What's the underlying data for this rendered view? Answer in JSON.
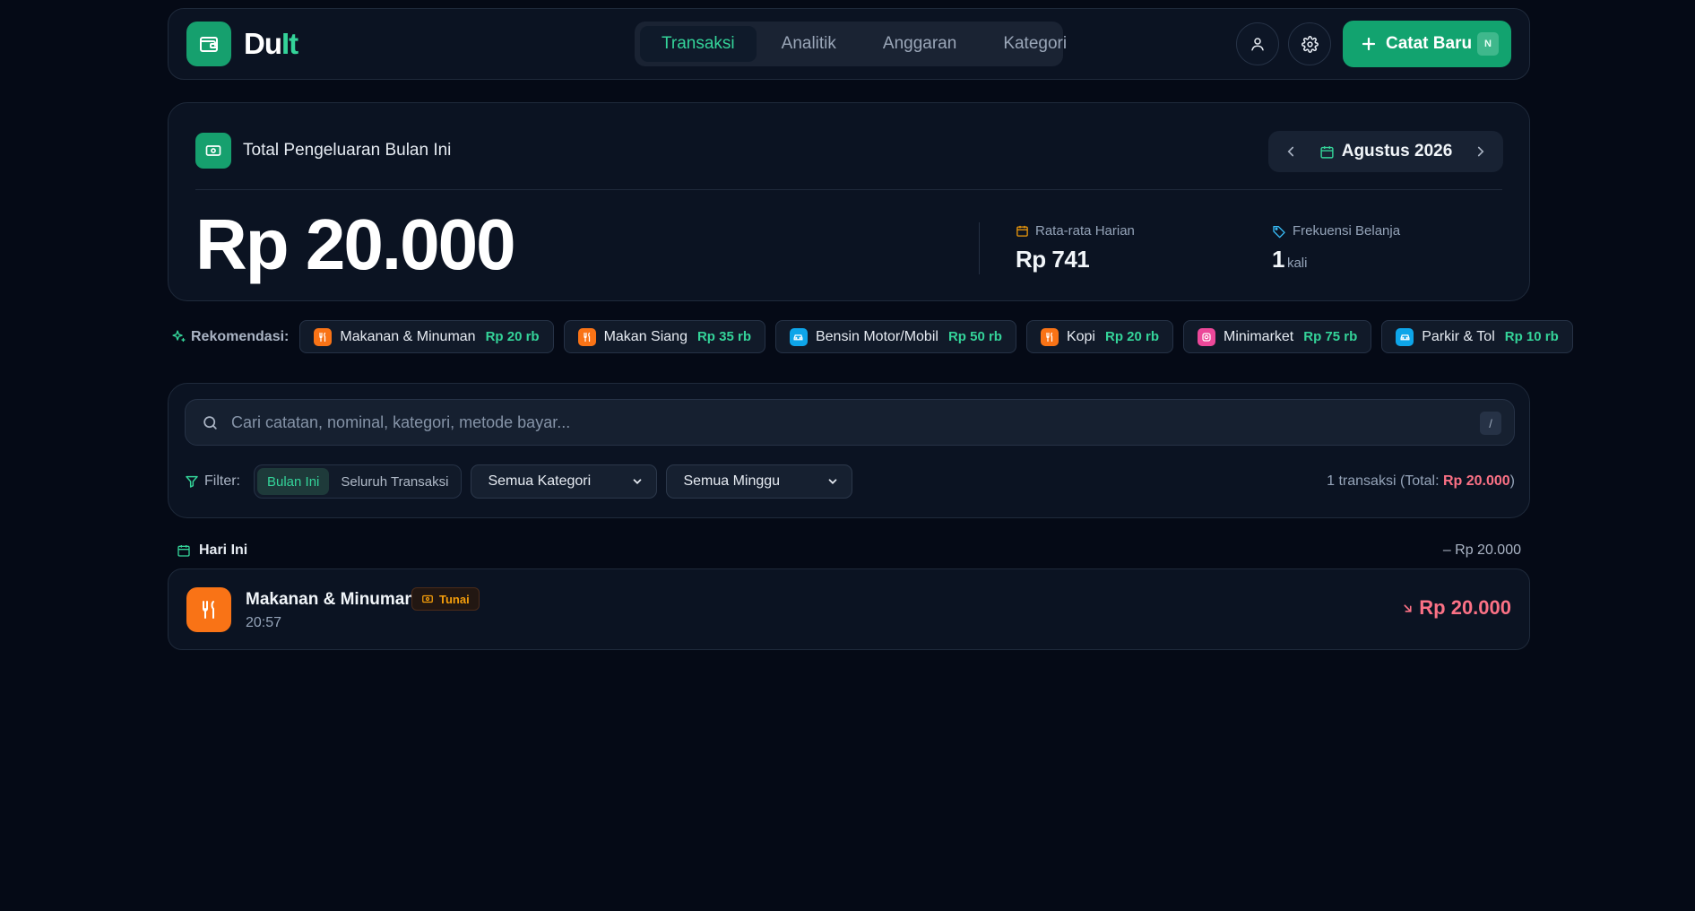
{
  "app": {
    "name_main": "Du",
    "name_accent": "It"
  },
  "nav": {
    "tabs": [
      {
        "label": "Transaksi",
        "active": true
      },
      {
        "label": "Analitik",
        "active": false
      },
      {
        "label": "Anggaran",
        "active": false
      },
      {
        "label": "Kategori",
        "active": false
      }
    ]
  },
  "header": {
    "profile_icon": "user-icon",
    "settings_icon": "gear-icon",
    "new_button_label": "Catat Baru",
    "new_button_shortcut": "N"
  },
  "summary": {
    "title": "Total Pengeluaran Bulan Ini",
    "month": "Agustus 2026",
    "total": "Rp 20.000",
    "daily_avg_label": "Rata-rata Harian",
    "daily_avg_value": "Rp 741",
    "frequency_label": "Frekuensi Belanja",
    "frequency_value": "1",
    "frequency_unit": "kali"
  },
  "recommendations": {
    "label": "Rekomendasi:",
    "items": [
      {
        "name": "Makanan & Minuman",
        "price": "Rp 20 rb",
        "icon": "utensils-icon",
        "color": "#f97316"
      },
      {
        "name": "Makan Siang",
        "price": "Rp 35 rb",
        "icon": "utensils-icon",
        "color": "#f97316"
      },
      {
        "name": "Bensin Motor/Mobil",
        "price": "Rp 50 rb",
        "icon": "car-icon",
        "color": "#0ea5e9"
      },
      {
        "name": "Kopi",
        "price": "Rp 20 rb",
        "icon": "utensils-icon",
        "color": "#f97316"
      },
      {
        "name": "Minimarket",
        "price": "Rp 75 rb",
        "icon": "shopping-icon",
        "color": "#ec4899"
      },
      {
        "name": "Parkir & Tol",
        "price": "Rp 10 rb",
        "icon": "car-icon",
        "color": "#0ea5e9"
      }
    ]
  },
  "search": {
    "placeholder": "Cari catatan, nominal, kategori, metode bayar...",
    "value": "",
    "shortcut": "/"
  },
  "filter": {
    "label": "Filter:",
    "period_options": [
      {
        "label": "Bulan Ini",
        "active": true
      },
      {
        "label": "Seluruh Transaksi",
        "active": false
      }
    ],
    "category_selected": "Semua Kategori",
    "week_selected": "Semua Minggu",
    "count_prefix": "1 transaksi (Total: ",
    "count_total": "Rp 20.000",
    "count_suffix": ")"
  },
  "day_group": {
    "label": "Hari Ini",
    "total": "– Rp 20.000"
  },
  "transactions": [
    {
      "title": "Makanan & Minuman",
      "method": "Tunai",
      "time": "20:57",
      "amount": "Rp 20.000",
      "icon": "utensils-icon"
    }
  ],
  "colors": {
    "background": "#050a16",
    "card": "#0b1322",
    "accent": "#34d399",
    "brand": "#12a36f",
    "expense": "#fb7185",
    "food": "#f97316"
  }
}
